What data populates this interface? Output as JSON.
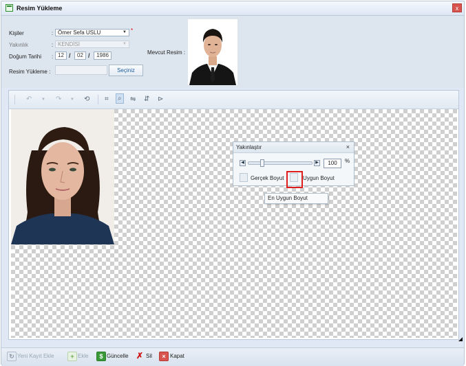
{
  "window": {
    "title": "Resim Yükleme",
    "close_glyph": "x"
  },
  "form": {
    "kisiler": {
      "label": "Kişiler",
      "value": "Ömer Sefa USLU",
      "required_mark": "*"
    },
    "yakinlik": {
      "label": "Yakınlık",
      "value": "KENDİSİ"
    },
    "dogum_tarihi": {
      "label": "Doğum Tarihi",
      "day": "12",
      "month": "02",
      "year": "1986",
      "separator": "/"
    },
    "resim_yukleme": {
      "label": "Resim Yükleme :",
      "button": "Seçiniz"
    },
    "mevcut_resim": {
      "label": "Mevcut Resim :"
    },
    "colon": ":"
  },
  "toolbar": {
    "icons": [
      "undo-icon",
      "dropdown-icon",
      "redo-icon",
      "dropdown-icon",
      "rotate-icon",
      "crop-icon",
      "zoom-icon",
      "flip-horizontal-icon",
      "flip-vertical-icon",
      "send-icon"
    ]
  },
  "zoom_dialog": {
    "title": "Yakınlaştır",
    "close": "×",
    "percent_value": "100",
    "percent_unit": "%",
    "slider_level_percent": 100,
    "gercek_boyut": "Gerçek Boyut",
    "uygun_boyut": "Uygun Boyut",
    "tooltip": "En Uygun Boyut"
  },
  "footer": {
    "yeni_kayit": "Yeni Kayıt Ekle",
    "ekle": "Ekle",
    "guncelle": "Güncelle",
    "sil": "Sil",
    "kapat": "Kapat"
  },
  "colors": {
    "accent": "#1a5a9a",
    "highlight": "#e01b1b",
    "close": "#d9534f"
  }
}
